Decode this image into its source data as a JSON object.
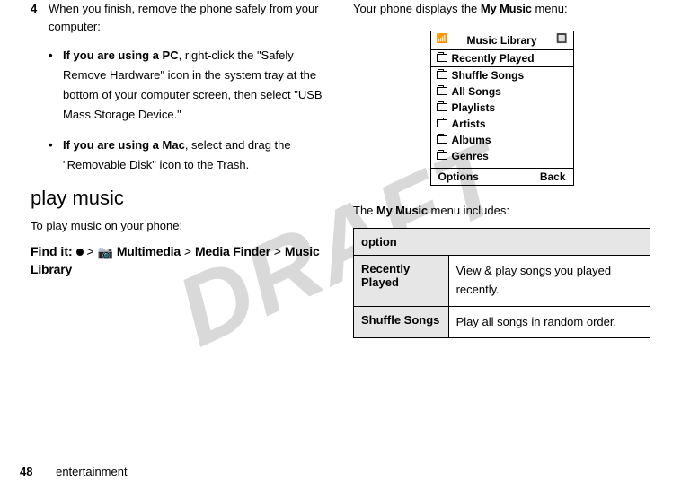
{
  "watermark": "DRAFT",
  "left": {
    "step_num": "4",
    "step_text": "When you finish, remove the phone safely from your computer:",
    "bullet1_bold": "If you are using a PC",
    "bullet1_rest": ", right-click the \"Safely Remove Hardware\" icon in the system tray at the bottom of your computer screen, then select \"USB Mass Storage Device.\"",
    "bullet2_bold": "If you are using a Mac",
    "bullet2_rest": ", select and drag the \"Removable Disk\" icon to the Trash.",
    "heading": "play music",
    "intro": "To play music on your phone:",
    "find_label": "Find it:",
    "path1": "Multimedia",
    "path2": "Media Finder",
    "path3": "Music Library"
  },
  "right": {
    "intro_pre": "Your phone displays the ",
    "intro_bold": "My Music",
    "intro_post": " menu:",
    "menu_title": "Music Library",
    "items": [
      "Recently Played",
      "Shuffle Songs",
      "All Songs",
      "Playlists",
      "Artists",
      "Albums",
      "Genres"
    ],
    "soft_left": "Options",
    "soft_right": "Back",
    "includes_pre": "The ",
    "includes_bold": "My Music",
    "includes_post": " menu includes:",
    "table_header": "option",
    "row1_label": "Recently Played",
    "row1_desc": "View & play songs you played recently.",
    "row2_label": "Shuffle Songs",
    "row2_desc": "Play all songs in random order."
  },
  "footer": {
    "page": "48",
    "section": "entertainment"
  }
}
